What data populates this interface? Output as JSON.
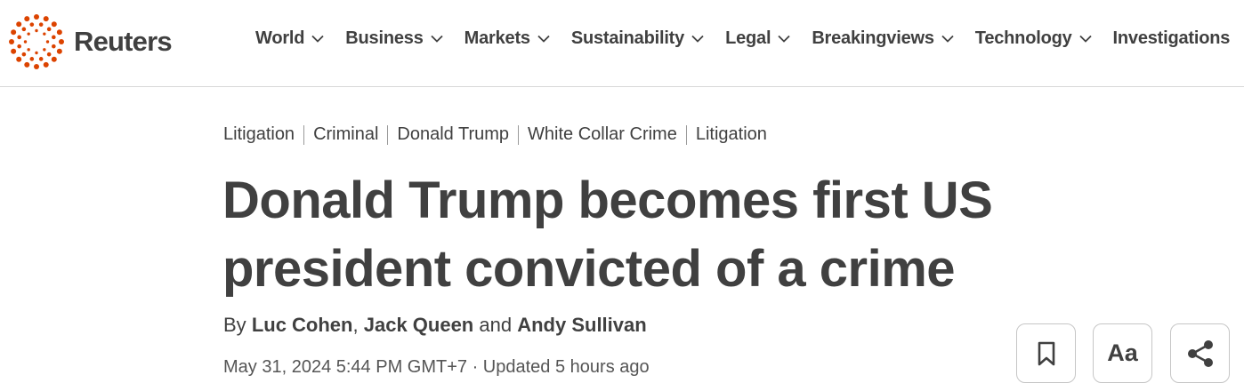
{
  "brand": {
    "name": "Reuters",
    "accent": "#dc4300"
  },
  "nav": {
    "items": [
      {
        "label": "World"
      },
      {
        "label": "Business"
      },
      {
        "label": "Markets"
      },
      {
        "label": "Sustainability"
      },
      {
        "label": "Legal"
      },
      {
        "label": "Breakingviews"
      },
      {
        "label": "Technology"
      },
      {
        "label": "Investigations"
      }
    ],
    "chevron_icon": "chevron-down-icon"
  },
  "breadcrumb": [
    "Litigation",
    "Criminal",
    "Donald Trump",
    "White Collar Crime",
    "Litigation"
  ],
  "article": {
    "headline": "Donald Trump becomes first US president convicted of a crime",
    "byline": {
      "prefix": "By",
      "authors": [
        "Luc Cohen",
        "Jack Queen",
        "Andy Sullivan"
      ],
      "separator_1": ",",
      "separator_2": "and"
    },
    "date": "May 31, 2024 5:44 PM GMT+7",
    "updated": "· Updated 5 hours ago"
  },
  "actions": {
    "bookmark_icon": "bookmark-icon",
    "font_label": "Aa",
    "share_icon": "share-icon"
  }
}
